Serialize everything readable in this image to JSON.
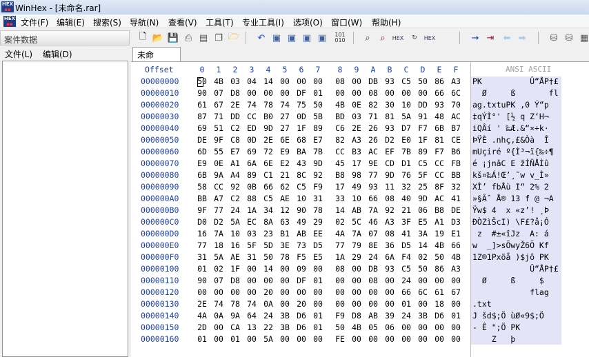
{
  "window": {
    "title": "WinHex - [未命名.rar]"
  },
  "menu": [
    "文件(F)",
    "编辑(E)",
    "搜索(S)",
    "导航(N)",
    "查看(V)",
    "工具(T)",
    "专业工具(I)",
    "选项(O)",
    "窗口(W)",
    "帮助(H)"
  ],
  "left_panel": {
    "title": "案件数据",
    "menu": [
      "文件(L)",
      "编辑(D)"
    ]
  },
  "tab": {
    "label": "未命名.rar"
  },
  "toolbar_icons": [
    "new-file-icon",
    "open-file-icon",
    "save-icon",
    "print-icon",
    "properties-icon",
    "copy-icon",
    "open-folder-icon",
    "undo-icon",
    "copy-block-icon",
    "copy-hex-icon",
    "paste-icon",
    "clipboard-icon",
    "hex-binary-icon",
    "find-icon",
    "find-text-icon",
    "find-hex-icon",
    "replace-icon",
    "replace-hex-icon",
    "goto-offset-icon",
    "goto-icon",
    "back-arrow-icon",
    "forward-arrow-icon",
    "disk-icon",
    "disk-tools-icon",
    "ram-icon"
  ],
  "hex": {
    "offset_header": "Offset",
    "columns": [
      "0",
      "1",
      "2",
      "3",
      "4",
      "5",
      "6",
      "7",
      "8",
      "9",
      "A",
      "B",
      "C",
      "D",
      "E",
      "F"
    ],
    "ansi_header": "ANSI ASCII",
    "rows": [
      {
        "off": "00000000",
        "bytes": [
          "50",
          "4B",
          "03",
          "04",
          "14",
          "00",
          "00",
          "00",
          "08",
          "00",
          "DB",
          "93",
          "C5",
          "50",
          "86",
          "A3"
        ],
        "ascii": "PK          Û“ÅP†£"
      },
      {
        "off": "00000010",
        "bytes": [
          "90",
          "07",
          "D8",
          "00",
          "00",
          "00",
          "DF",
          "01",
          "00",
          "00",
          "08",
          "00",
          "00",
          "00",
          "66",
          "6C"
        ],
        "ascii": "  Ø     ß       fl"
      },
      {
        "off": "00000020",
        "bytes": [
          "61",
          "67",
          "2E",
          "74",
          "78",
          "74",
          "75",
          "50",
          "4B",
          "0E",
          "82",
          "30",
          "10",
          "DD",
          "93",
          "70"
        ],
        "ascii": "ag.txtuPK ‚0 Ý“p"
      },
      {
        "off": "00000030",
        "bytes": [
          "87",
          "71",
          "DD",
          "CC",
          "B0",
          "27",
          "0D",
          "5B",
          "BD",
          "03",
          "71",
          "81",
          "5A",
          "91",
          "48",
          "AC"
        ],
        "ascii": "‡qÝÌ°' [½ q Z‘H¬"
      },
      {
        "off": "00000040",
        "bytes": [
          "69",
          "51",
          "C2",
          "ED",
          "9D",
          "27",
          "1F",
          "89",
          "C6",
          "2E",
          "26",
          "93",
          "D7",
          "F7",
          "6B",
          "B7"
        ],
        "ascii": "iQÂí ' ‰Æ.&“×÷k·"
      },
      {
        "off": "00000050",
        "bytes": [
          "DE",
          "9F",
          "C8",
          "0D",
          "2E",
          "6E",
          "68",
          "E7",
          "82",
          "A3",
          "26",
          "D2",
          "E0",
          "1F",
          "81",
          "CE"
        ],
        "ascii": "ÞŸÈ .nhç‚£&Òà  Î"
      },
      {
        "off": "00000060",
        "bytes": [
          "6D",
          "55",
          "E7",
          "69",
          "72",
          "E9",
          "BA",
          "7B",
          "CC",
          "B3",
          "AC",
          "EF",
          "7B",
          "89",
          "F7",
          "B6"
        ],
        "ascii": "mUçiré º{Ì³¬ï{‰÷¶"
      },
      {
        "off": "00000070",
        "bytes": [
          "E9",
          "0E",
          "A1",
          "6A",
          "6E",
          "E2",
          "43",
          "9D",
          "45",
          "17",
          "9E",
          "CD",
          "D1",
          "C5",
          "CC",
          "FB"
        ],
        "ascii": "é ¡jnâC E žÍÑÅÌû"
      },
      {
        "off": "00000080",
        "bytes": [
          "6B",
          "9A",
          "A4",
          "89",
          "C1",
          "21",
          "8C",
          "92",
          "B8",
          "98",
          "77",
          "9D",
          "76",
          "5F",
          "CC",
          "BB"
        ],
        "ascii": "kš¤‰Á!Œ’¸˜w v_Ì»"
      },
      {
        "off": "00000090",
        "bytes": [
          "58",
          "CC",
          "92",
          "0B",
          "66",
          "62",
          "C5",
          "F9",
          "17",
          "49",
          "93",
          "11",
          "32",
          "25",
          "8F",
          "32"
        ],
        "ascii": "XÌ’ fbÅù I“ 2% 2"
      },
      {
        "off": "000000A0",
        "bytes": [
          "BB",
          "A7",
          "C2",
          "88",
          "C5",
          "AE",
          "10",
          "31",
          "33",
          "10",
          "66",
          "08",
          "40",
          "9D",
          "AC",
          "41"
        ],
        "ascii": "»§Âˆ Å® 13 f @ ¬A"
      },
      {
        "off": "000000B0",
        "bytes": [
          "9F",
          "77",
          "24",
          "1A",
          "34",
          "12",
          "90",
          "78",
          "14",
          "AB",
          "7A",
          "92",
          "21",
          "06",
          "B8",
          "DE"
        ],
        "ascii": "Ÿw$ 4  x «z’! ¸Þ"
      },
      {
        "off": "000000C0",
        "bytes": [
          "D0",
          "D2",
          "5A",
          "EC",
          "8A",
          "63",
          "49",
          "29",
          "02",
          "5C",
          "46",
          "A3",
          "3F",
          "E5",
          "A1",
          "D3"
        ],
        "ascii": "ÐÒZìŠcI) \\F£?å¡Ó"
      },
      {
        "off": "000000D0",
        "bytes": [
          "16",
          "7A",
          "10",
          "03",
          "23",
          "B1",
          "AB",
          "EE",
          "4A",
          "7A",
          "07",
          "08",
          "41",
          "3A",
          "19",
          "E1"
        ],
        "ascii": " z  #±«îJz  A: á"
      },
      {
        "off": "000000E0",
        "bytes": [
          "77",
          "18",
          "16",
          "5F",
          "5D",
          "3E",
          "73",
          "D5",
          "77",
          "79",
          "8E",
          "36",
          "D5",
          "14",
          "4B",
          "66"
        ],
        "ascii": "w  _]>sÕwyŽ6Õ Kf"
      },
      {
        "off": "000000F0",
        "bytes": [
          "31",
          "5A",
          "AE",
          "31",
          "50",
          "78",
          "F5",
          "E5",
          "1A",
          "29",
          "24",
          "6A",
          "F4",
          "02",
          "50",
          "4B"
        ],
        "ascii": "1Z®1Pxõå )$jô PK"
      },
      {
        "off": "00000100",
        "bytes": [
          "01",
          "02",
          "1F",
          "00",
          "14",
          "00",
          "09",
          "00",
          "08",
          "00",
          "DB",
          "93",
          "C5",
          "50",
          "86",
          "A3"
        ],
        "ascii": "            Û“ÅP†£"
      },
      {
        "off": "00000110",
        "bytes": [
          "90",
          "07",
          "D8",
          "00",
          "00",
          "00",
          "DF",
          "01",
          "00",
          "00",
          "08",
          "00",
          "24",
          "00",
          "00",
          "00"
        ],
        "ascii": "  Ø     ß     $"
      },
      {
        "off": "00000120",
        "bytes": [
          "00",
          "00",
          "00",
          "00",
          "20",
          "00",
          "00",
          "00",
          "00",
          "00",
          "00",
          "00",
          "66",
          "6C",
          "61",
          "67"
        ],
        "ascii": "            flag"
      },
      {
        "off": "00000130",
        "bytes": [
          "2E",
          "74",
          "78",
          "74",
          "0A",
          "00",
          "20",
          "00",
          "00",
          "00",
          "00",
          "00",
          "01",
          "00",
          "18",
          "00"
        ],
        "ascii": ".txt"
      },
      {
        "off": "00000140",
        "bytes": [
          "4A",
          "0A",
          "9A",
          "64",
          "24",
          "3B",
          "D6",
          "01",
          "F9",
          "D8",
          "AB",
          "39",
          "24",
          "3B",
          "D6",
          "01"
        ],
        "ascii": "J šd$;Ö ùØ«9$;Ö"
      },
      {
        "off": "00000150",
        "bytes": [
          "2D",
          "00",
          "CA",
          "13",
          "22",
          "3B",
          "D6",
          "01",
          "50",
          "4B",
          "05",
          "06",
          "00",
          "00",
          "00",
          "00"
        ],
        "ascii": "- Ê \";Ö PK"
      },
      {
        "off": "00000160",
        "bytes": [
          "01",
          "00",
          "01",
          "00",
          "5A",
          "00",
          "00",
          "00",
          "FE",
          "00",
          "00",
          "00",
          "00",
          "00",
          "00",
          "00"
        ],
        "ascii": "    Z   þ"
      }
    ]
  }
}
